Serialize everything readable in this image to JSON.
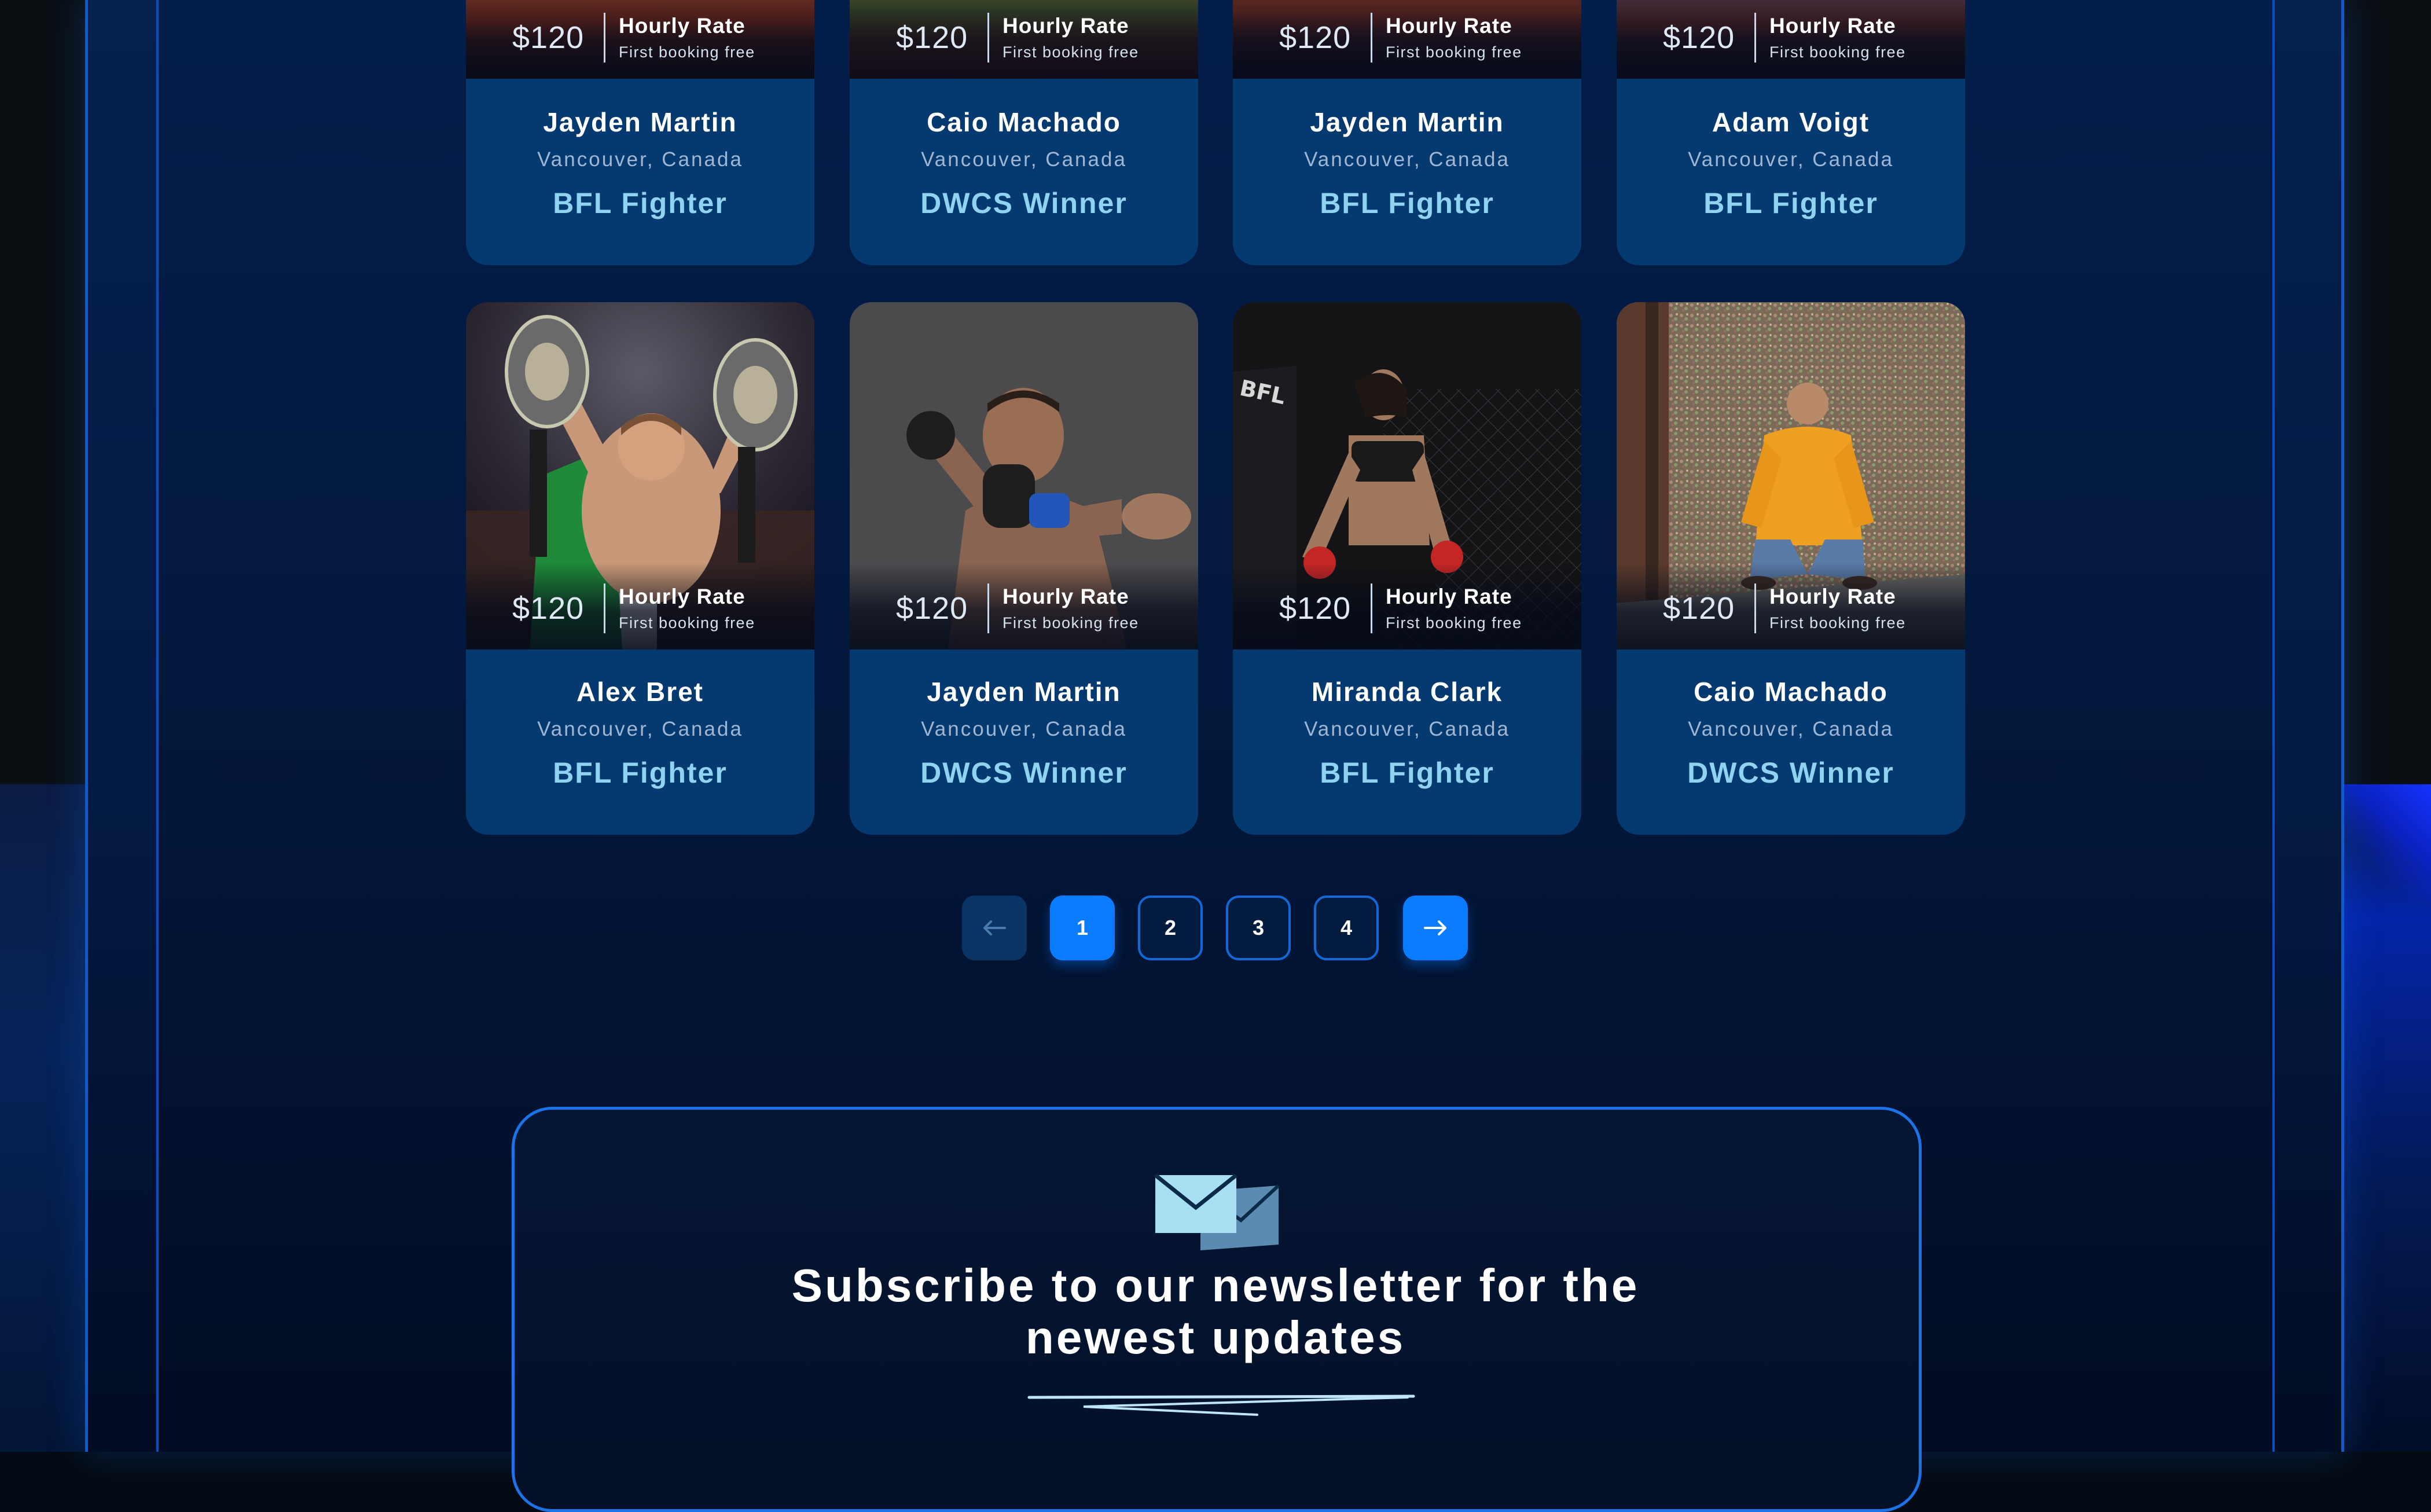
{
  "rate_card": {
    "price": "$120",
    "title": "Hourly Rate",
    "subtitle": "First booking free"
  },
  "fighters": [
    {
      "name": "Jayden Martin",
      "location": "Vancouver, Canada",
      "title": "BFL Fighter"
    },
    {
      "name": "Caio Machado",
      "location": "Vancouver, Canada",
      "title": "DWCS Winner"
    },
    {
      "name": "Jayden Martin",
      "location": "Vancouver, Canada",
      "title": "BFL Fighter"
    },
    {
      "name": "Adam Voigt",
      "location": "Vancouver, Canada",
      "title": "BFL Fighter"
    },
    {
      "name": "Alex Bret",
      "location": "Vancouver, Canada",
      "title": "BFL Fighter"
    },
    {
      "name": "Jayden Martin",
      "location": "Vancouver, Canada",
      "title": "DWCS Winner"
    },
    {
      "name": "Miranda Clark",
      "location": "Vancouver, Canada",
      "title": "BFL Fighter"
    },
    {
      "name": "Caio Machado",
      "location": "Vancouver, Canada",
      "title": "DWCS Winner"
    }
  ],
  "pagination": {
    "prev_icon": "arrow-left-icon",
    "pages": [
      "1",
      "2",
      "3",
      "4"
    ],
    "active_page": "1",
    "next_icon": "arrow-right-icon"
  },
  "newsletter": {
    "icon": "envelope-icon",
    "heading_line_1": "Subscribe to our newsletter for the",
    "heading_line_2": "newest updates"
  },
  "colors": {
    "accent": "#0a7cff",
    "card_bg": "#053a70",
    "title_text": "#8fd3f0",
    "panel_border": "#1a73e8"
  }
}
